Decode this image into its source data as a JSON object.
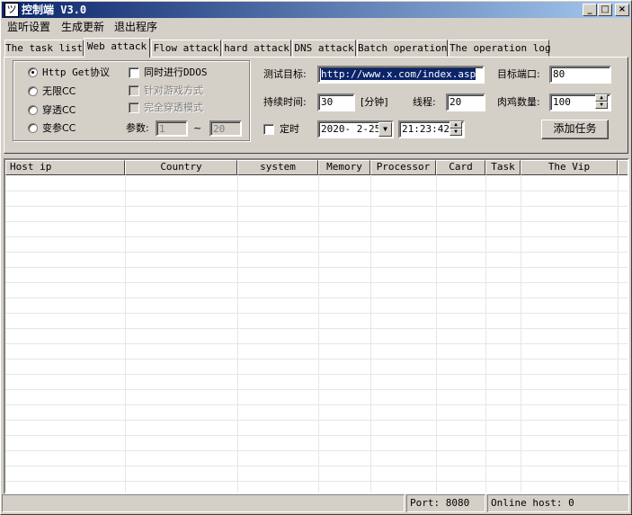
{
  "window": {
    "title": "控制端 V3.0",
    "icon_text": "ツ",
    "min": "_",
    "max": "□",
    "close": "×"
  },
  "menu": [
    "监听设置",
    "生成更新",
    "退出程序"
  ],
  "tabs": [
    "The task list",
    "Web attack",
    "Flow attack",
    "hard attack",
    "DNS attack",
    "Batch operation",
    "The operation log"
  ],
  "active_tab": "Web attack",
  "web_attack": {
    "modes": [
      {
        "label": "Http Get协议",
        "selected": true
      },
      {
        "label": "无限CC",
        "selected": false
      },
      {
        "label": "穿透CC",
        "selected": false
      },
      {
        "label": "变参CC",
        "selected": false
      }
    ],
    "sync_ddos": {
      "label": "同时进行DDOS",
      "checked": false
    },
    "game_mode": {
      "label": "针对游戏方式",
      "checked": false
    },
    "full_penetrate": {
      "label": "完全穿透模式",
      "checked": false
    },
    "param_label": "参数:",
    "param_from": "1",
    "param_sep": "~",
    "param_to": "20",
    "target_label": "测试目标:",
    "target_value": "http://www.x.com/index.asp",
    "port_label": "目标端口:",
    "port_value": "80",
    "duration_label": "持续时间:",
    "duration_value": "30",
    "duration_unit": "[分钟]",
    "threads_label": "线程:",
    "threads_value": "20",
    "bots_label": "肉鸡数量:",
    "bots_value": "100",
    "timer": {
      "label": "定时",
      "checked": false
    },
    "date_value": "2020- 2-25",
    "time_value": "21:23:42",
    "add_task": "添加任务"
  },
  "table": {
    "columns": [
      "Host ip",
      "Country",
      "system",
      "Memory",
      "Processor",
      "Card",
      "Task",
      "The Vip"
    ],
    "rows": []
  },
  "status": {
    "port": "Port: 8080",
    "online": "Online host: 0"
  }
}
